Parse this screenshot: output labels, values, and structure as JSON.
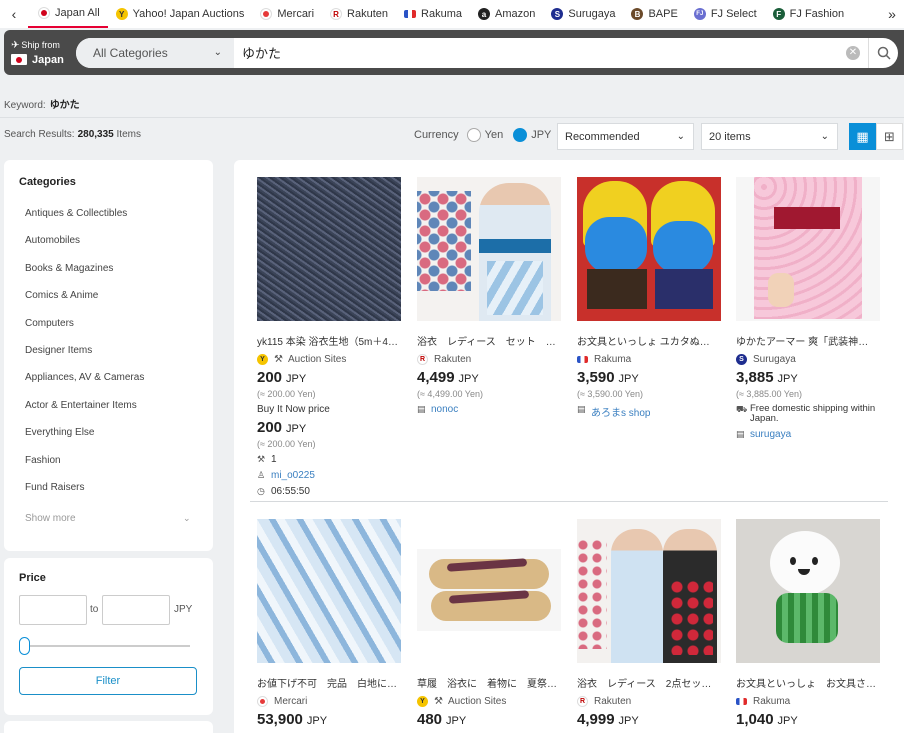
{
  "nav": {
    "prev": "‹",
    "next": "»",
    "tabs": [
      {
        "label": "Japan All",
        "icon": "japan-flag-icon",
        "color": "#d0021b",
        "glyph": ""
      },
      {
        "label": "Yahoo! Japan Auctions",
        "icon": "yahoo-auctions-icon",
        "color": "#f5c400",
        "glyph": "Y"
      },
      {
        "label": "Mercari",
        "icon": "mercari-icon",
        "color": "#e63a3a",
        "glyph": ""
      },
      {
        "label": "Rakuten",
        "icon": "rakuten-icon",
        "color": "#bf0000",
        "glyph": "R"
      },
      {
        "label": "Rakuma",
        "icon": "rakuma-icon",
        "color": "#2a53c6",
        "glyph": ""
      },
      {
        "label": "Amazon",
        "icon": "amazon-icon",
        "color": "#222222",
        "glyph": "a"
      },
      {
        "label": "Surugaya",
        "icon": "surugaya-icon",
        "color": "#1e2d8f",
        "glyph": "S"
      },
      {
        "label": "BAPE",
        "icon": "bape-icon",
        "color": "#6b4a2a",
        "glyph": "B"
      },
      {
        "label": "FJ Select",
        "icon": "fj-select-icon",
        "color": "#6a6fd1",
        "glyph": "FJ"
      },
      {
        "label": "FJ Fashion",
        "icon": "fj-fashion-icon",
        "color": "#1b5e3a",
        "glyph": "F"
      }
    ]
  },
  "search": {
    "ship_from_label": "Ship from",
    "ship_from_value": "Japan",
    "category": "All Categories",
    "query": "ゆかた"
  },
  "keyword": {
    "label": "Keyword:",
    "value": "ゆかた"
  },
  "results": {
    "label": "Search Results:",
    "count": "280,335",
    "unit": "Items"
  },
  "currency": {
    "label": "Currency",
    "yen": "Yen",
    "jpy": "JPY",
    "selected": "JPY"
  },
  "sort": {
    "value": "Recommended"
  },
  "per_page": {
    "value": "20 items"
  },
  "sidebar": {
    "categories_title": "Categories",
    "categories": [
      "Antiques & Collectibles",
      "Automobiles",
      "Books & Magazines",
      "Comics & Anime",
      "Computers",
      "Designer Items",
      "Appliances, AV & Cameras",
      "Actor & Entertainer Items",
      "Everything Else",
      "Fashion",
      "Fund Raisers"
    ],
    "show_more": "Show more",
    "price_title": "Price",
    "price_to": "to",
    "price_unit": "JPY",
    "filter_label": "Filter"
  },
  "products": [
    {
      "title": "yk115 本染 浴衣生地（5m＋4…",
      "source": "Auction Sites",
      "source_icon": "auction-sites-icon",
      "price": "200",
      "currency": "JPY",
      "yen": "(≈ 200.00 Yen)",
      "buy_label": "Buy It Now price",
      "buy_price": "200",
      "buy_yen": "(≈ 200.00 Yen)",
      "bids": "1",
      "seller": "mi_o0225",
      "time": "06:55:50"
    },
    {
      "title": "浴衣　レディース　セット　…",
      "source": "Rakuten",
      "source_icon": "rakuten-icon",
      "price": "4,499",
      "currency": "JPY",
      "yen": "(≈ 4,499.00 Yen)",
      "shop": "nonoc"
    },
    {
      "title": "お文具といっしょ ユカタぬい…",
      "source": "Rakuma",
      "source_icon": "rakuma-icon",
      "price": "3,590",
      "currency": "JPY",
      "yen": "(≈ 3,590.00 Yen)",
      "shop": "あろまs shop"
    },
    {
      "title": "ゆかたアーマー 爽「武装神姫」",
      "source": "Surugaya",
      "source_icon": "surugaya-icon",
      "price": "3,885",
      "currency": "JPY",
      "yen": "(≈ 3,885.00 Yen)",
      "shipping": "Free domestic shipping within Japan.",
      "shop": "surugaya"
    },
    {
      "title": "お値下げ不可　完品　白地に…",
      "source": "Mercari",
      "source_icon": "mercari-icon",
      "price": "53,900",
      "currency": "JPY"
    },
    {
      "title": "草履　浴衣に　着物に　夏祭…",
      "source": "Auction Sites",
      "source_icon": "auction-sites-icon",
      "price": "480",
      "currency": "JPY"
    },
    {
      "title": "浴衣　レディース　2点セット…",
      "source": "Rakuten",
      "source_icon": "rakuten-icon",
      "price": "4,999",
      "currency": "JPY"
    },
    {
      "title": "お文具といっしょ　お文具さ…",
      "source": "Rakuma",
      "source_icon": "rakuma-icon",
      "price": "1,040",
      "currency": "JPY"
    }
  ]
}
